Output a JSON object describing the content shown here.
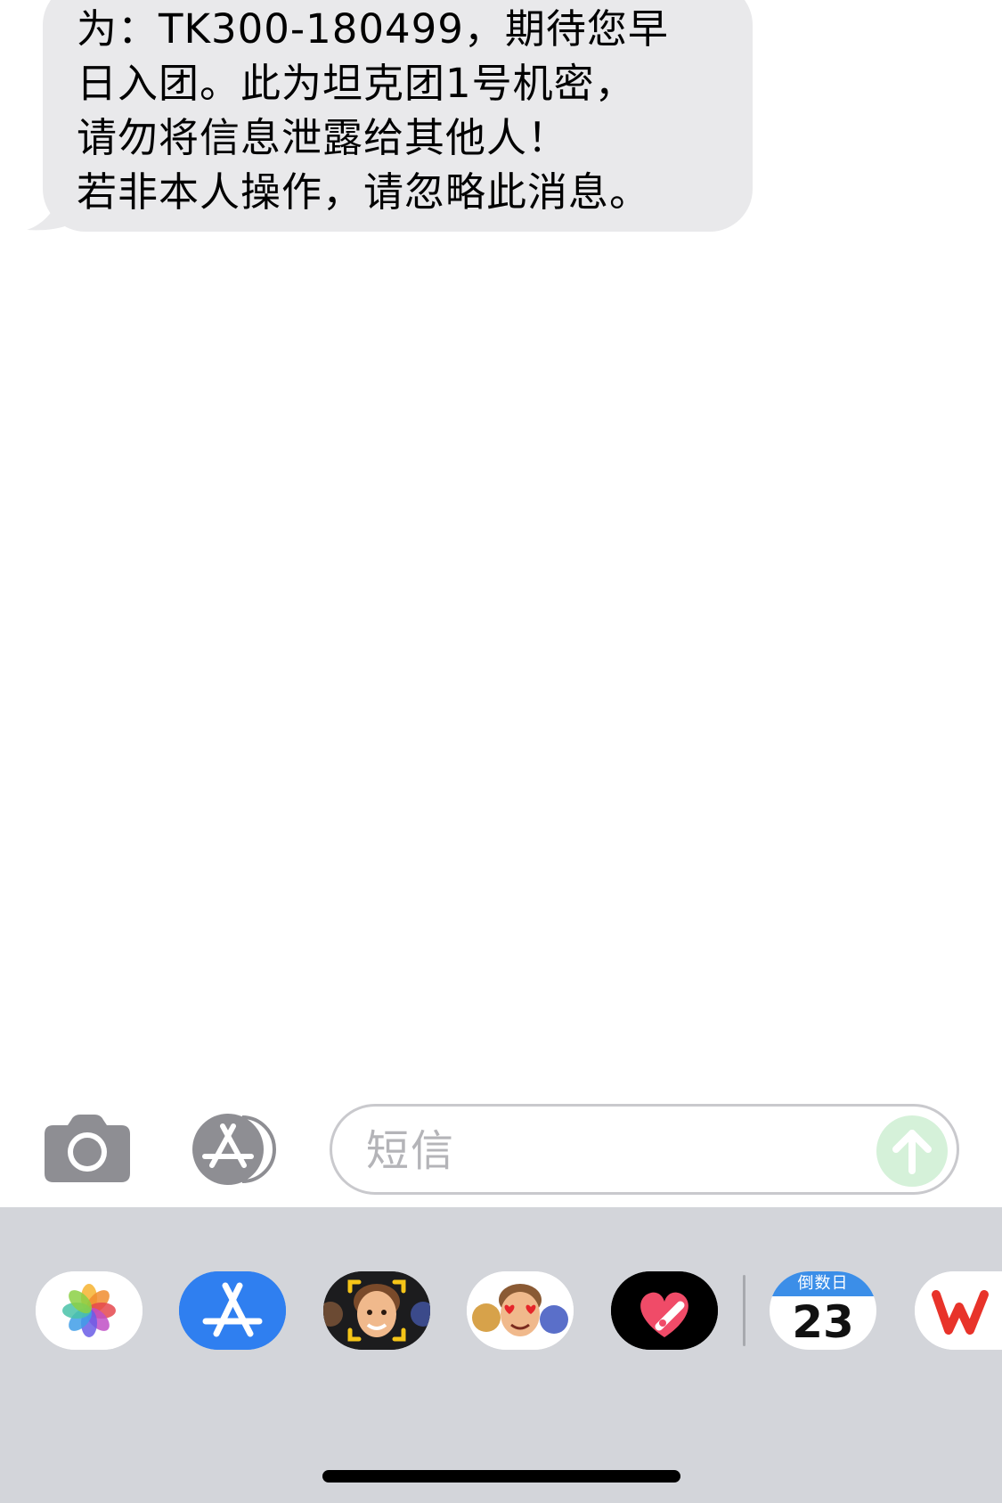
{
  "message": {
    "lines": [
      "为：TK300-180499，期待您早",
      "日入团。此为坦克团1号机密，",
      "请勿将信息泄露给其他人！",
      "若非本人操作，请忽略此消息。"
    ]
  },
  "compose": {
    "placeholder": "短信"
  },
  "app_drawer": {
    "apps": [
      {
        "name": "photos-app",
        "icon": "photos-icon"
      },
      {
        "name": "app-store-app",
        "icon": "app-store-icon"
      },
      {
        "name": "memoji-camera-app",
        "icon": "memoji-camera-icon"
      },
      {
        "name": "memoji-stickers-app",
        "icon": "memoji-stickers-icon"
      },
      {
        "name": "digital-touch-app",
        "icon": "heart-icon"
      },
      {
        "name": "countdown-app",
        "icon": "calendar-icon",
        "header": "倒数日",
        "number": "23"
      },
      {
        "name": "wps-app",
        "icon": "wps-icon"
      }
    ]
  },
  "colors": {
    "bubble": "#e9e9eb",
    "drawer": "#d3d5da",
    "send_button": "#d5f1d9",
    "app_store_blue": "#2f7ff0"
  }
}
